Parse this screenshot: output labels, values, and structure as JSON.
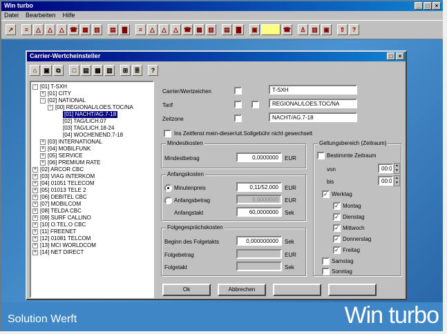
{
  "app_title": "Win turbo",
  "menu": [
    "Datei",
    "Bearbeiten",
    "Hilfe"
  ],
  "dialog": {
    "title": "Carrier-Wertcheinsteller",
    "help_label": "?",
    "fields": {
      "carrier_label": "Carrier/Wertzeichen",
      "carrier_value": "T-SXH",
      "tarif_label": "Tarif",
      "tarif_value": "REGIONAL/LOES.TOC/NA",
      "zeitzone_label": "Zeitzone",
      "zeitzone_value": "NACHT/AG.7-18",
      "zeitzone_check": "Ins Zeitfenst mein-dieser/uit.Sollgebühr nicht gewechselt"
    },
    "abrechnung": {
      "group_title": "Mindestkosten",
      "label": "Mindestbetrag",
      "value": "0,0000000",
      "unit": "EUR"
    },
    "anfang": {
      "group_title": "Anfangskosten",
      "opt1_label": "Minutenpreis",
      "opt1_value": "0,11/52.000",
      "opt1_unit": "EUR",
      "opt2_label": "Anfangsbetrag",
      "opt2_value": "0,0000000",
      "opt2_unit": "EUR",
      "takt_label": "Anfangstakt",
      "takt_value": "60,0000000",
      "takt_unit": "Sek"
    },
    "folge": {
      "group_title": "Folgegesprächskosten",
      "row1_label": "Beginn des Folgetakts",
      "row1_value": "0,000000000",
      "row1_unit": "Sek",
      "row2_label": "Folgebetrag",
      "row2_value": "",
      "row2_unit": "EUR",
      "row3_label": "Folgetakt",
      "row3_value": "",
      "row3_unit": "Sek"
    },
    "zeitbereich": {
      "group_title": "Geltungsbereich (Zeitraum)",
      "check_label": "Bestimmte Zeitraum",
      "von_label": "von",
      "von_value": "00:00",
      "bis_label": "bis",
      "bis_value": "00:00",
      "werktag_label": "Werktag",
      "days": [
        "Montag",
        "Dienstag",
        "Mittwoch",
        "Donnerstag",
        "Freitag",
        "Samstag",
        "Sonntag"
      ]
    },
    "buttons": {
      "ok": "Ok",
      "cancel": "Abbrechen"
    },
    "tree": [
      {
        "label": "[01] T-SXH",
        "level": 0,
        "exp": "-"
      },
      {
        "label": "[01] CITY",
        "level": 1,
        "exp": "+"
      },
      {
        "label": "[02] NATIONAL",
        "level": 1,
        "exp": "-"
      },
      {
        "label": "[00] REGIONAL/LOES.TOC/NA",
        "level": 2,
        "exp": "-"
      },
      {
        "label": "[01] NACHT/AG.7-18",
        "level": 3,
        "exp": "",
        "sel": true
      },
      {
        "label": "[02] TAG/LICH.07",
        "level": 3,
        "exp": ""
      },
      {
        "label": "[03] TAG/LICH.18-24",
        "level": 3,
        "exp": ""
      },
      {
        "label": "[04] WOCHENEND.7-18",
        "level": 3,
        "exp": ""
      },
      {
        "label": "[03] INTERNATIONAL",
        "level": 1,
        "exp": "+"
      },
      {
        "label": "[04] MOBILFUNK",
        "level": 1,
        "exp": "+"
      },
      {
        "label": "[05] SERVICE",
        "level": 1,
        "exp": "+"
      },
      {
        "label": "[06] PREMIUM RATE",
        "level": 1,
        "exp": "+"
      },
      {
        "label": "[02] ARCOR CBC",
        "level": 0,
        "exp": "+"
      },
      {
        "label": "[03] VIAG INTERKOM",
        "level": 0,
        "exp": "+"
      },
      {
        "label": "[04] 01051 TELECOM",
        "level": 0,
        "exp": "+"
      },
      {
        "label": "[05] 01013 TELE 2",
        "level": 0,
        "exp": "+"
      },
      {
        "label": "[06] DEBITEL CBC",
        "level": 0,
        "exp": "+"
      },
      {
        "label": "[07] MOBILCOM",
        "level": 0,
        "exp": "+"
      },
      {
        "label": "[08] TELDA CBC",
        "level": 0,
        "exp": "+"
      },
      {
        "label": "[09] SURF CALLINO",
        "level": 0,
        "exp": "+"
      },
      {
        "label": "[10] O.TEL.O CBC",
        "level": 0,
        "exp": "+"
      },
      {
        "label": "[11] FREENET",
        "level": 0,
        "exp": "+"
      },
      {
        "label": "[12] 01081 TELCOM",
        "level": 0,
        "exp": "+"
      },
      {
        "label": "[13] MCI WORLDCOM",
        "level": 0,
        "exp": "+"
      },
      {
        "label": "[14] NET DIRECT",
        "level": 0,
        "exp": "+"
      }
    ]
  },
  "footer": {
    "left": "Solution Werft",
    "right": "Win turbo"
  }
}
